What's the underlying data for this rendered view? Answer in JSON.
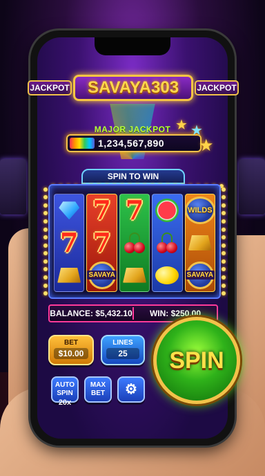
{
  "header": {
    "jackpot_left": "JACKPOT",
    "logo": "SAVAYA303",
    "jackpot_right": "JACKPOT"
  },
  "major_jackpot": {
    "label": "MAJOR JACKPOT",
    "value": "1,234,567,890"
  },
  "reels": {
    "title": "SPIN TO WIN",
    "columns": [
      [
        "diamond-icon",
        "seven-icon",
        "gold-bar-icon"
      ],
      [
        "seven-icon",
        "seven-icon",
        "savaya-coin-icon"
      ],
      [
        "seven-icon",
        "cherry-icon",
        "gold-bar-icon"
      ],
      [
        "watermelon-icon",
        "cherry-icon",
        "lemon-icon"
      ],
      [
        "wilds-icon",
        "gold-bar-icon",
        "savaya-coin-icon"
      ]
    ],
    "coin_text": "SAVAYA",
    "wilds_text": "WILDS",
    "seven_text": "7"
  },
  "status": {
    "balance": "BALANCE: $5,432.10",
    "win": "WIN: $250.00"
  },
  "controls": {
    "bet_label": "BET",
    "bet_value": "$10.00",
    "lines_label": "LINES",
    "lines_value": "25",
    "auto_spin_line1": "AUTO",
    "auto_spin_line2": "SPIN",
    "auto_spin_count": "20x",
    "max_bet_line1": "MAX",
    "max_bet_line2": "BET",
    "settings_icon": "gear-icon",
    "spin_label": "SPIN"
  },
  "colors": {
    "accent_gold": "#f2c24a",
    "spin_green": "#2fb21a",
    "balance_border": "#ff3a9a"
  }
}
